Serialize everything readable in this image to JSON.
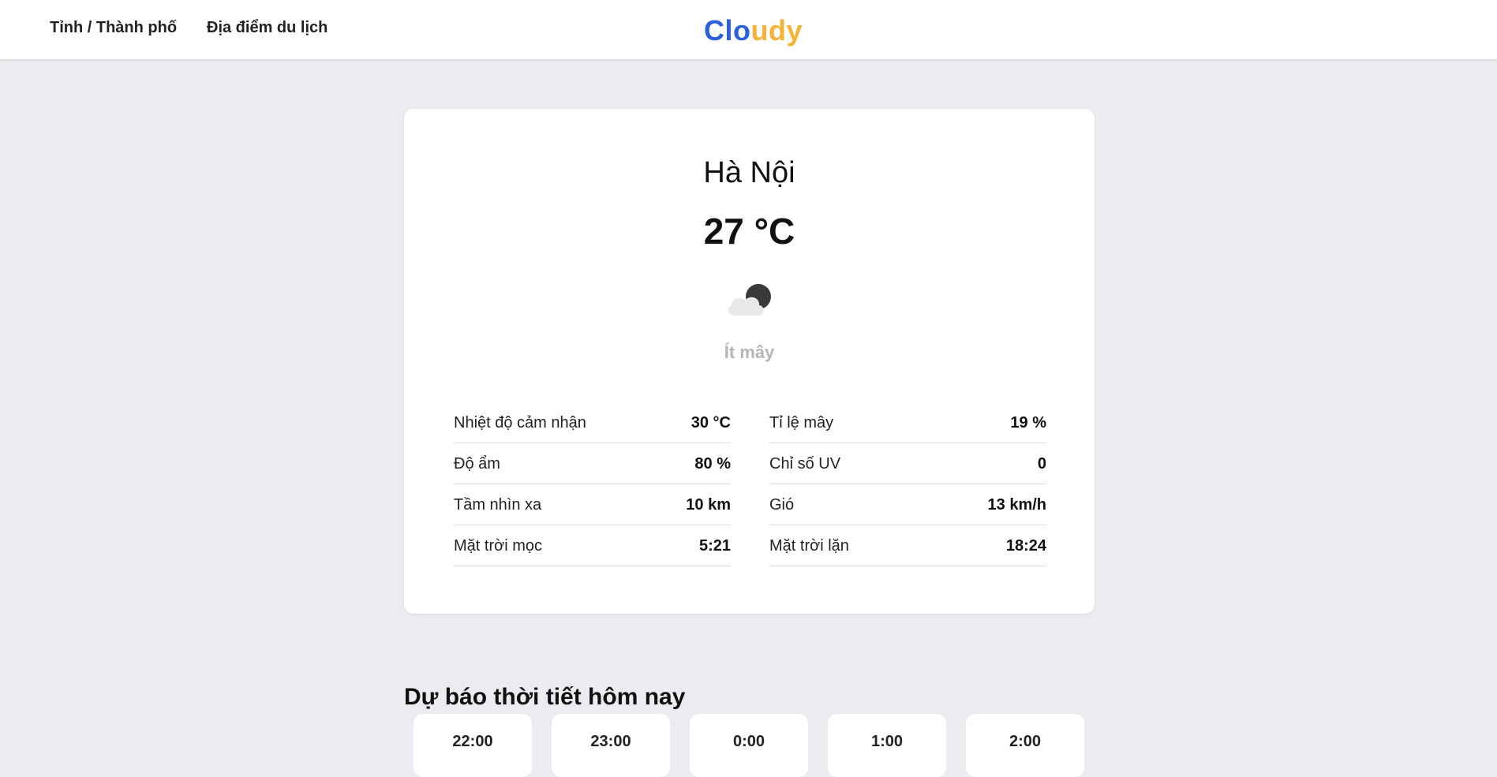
{
  "nav": {
    "items": [
      {
        "label": "Tỉnh / Thành phố"
      },
      {
        "label": "Địa điểm du lịch"
      }
    ]
  },
  "logo": {
    "part1": "Clo",
    "part2": "udy",
    "colors": {
      "part1": "#2b5fdc",
      "part2": "#f5b234"
    }
  },
  "current": {
    "city": "Hà Nội",
    "temperature": "27 °C",
    "icon": "partly-cloudy-night-icon",
    "condition": "Ít mây"
  },
  "details": {
    "left": [
      {
        "label": "Nhiệt độ cảm nhận",
        "value": "30 °C"
      },
      {
        "label": "Độ ẩm",
        "value": "80 %"
      },
      {
        "label": "Tầm nhìn xa",
        "value": "10 km"
      },
      {
        "label": "Mặt trời mọc",
        "value": "5:21"
      }
    ],
    "right": [
      {
        "label": "Tỉ lệ mây",
        "value": "19 %"
      },
      {
        "label": "Chỉ số UV",
        "value": "0"
      },
      {
        "label": "Gió",
        "value": "13 km/h"
      },
      {
        "label": "Mặt trời lặn",
        "value": "18:24"
      }
    ]
  },
  "forecast": {
    "title": "Dự báo thời tiết hôm nay",
    "hours": [
      {
        "time": "22:00"
      },
      {
        "time": "23:00"
      },
      {
        "time": "0:00"
      },
      {
        "time": "1:00"
      },
      {
        "time": "2:00"
      }
    ]
  }
}
